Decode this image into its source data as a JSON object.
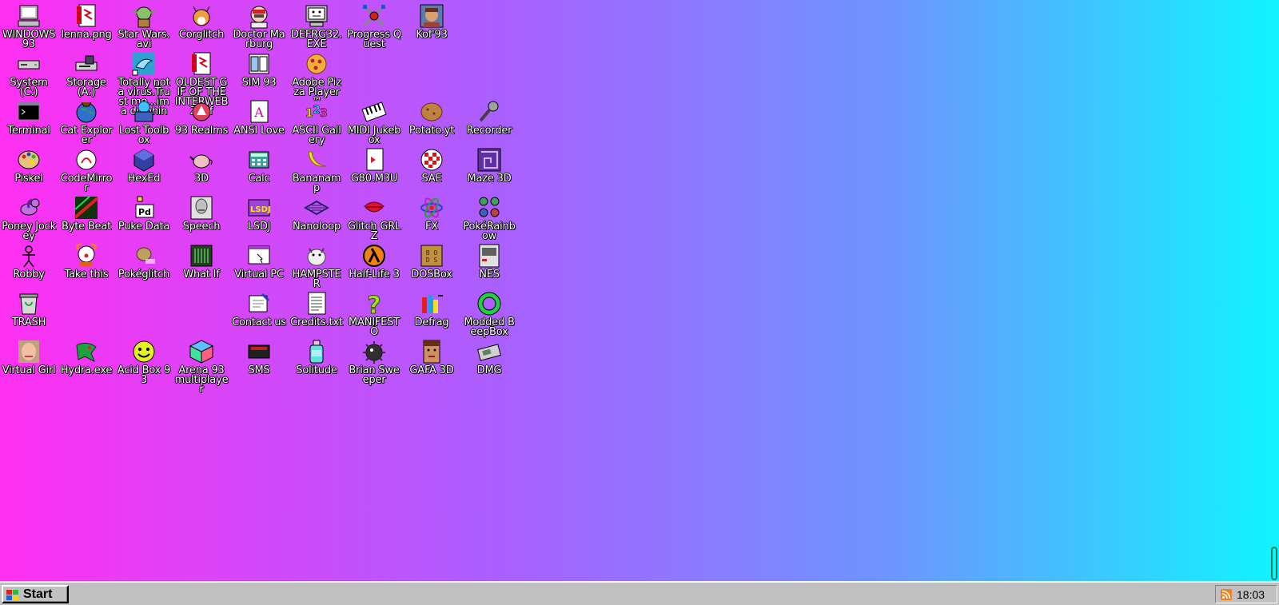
{
  "desktop": {
    "icons": [
      {
        "label": "WINDOWS 93",
        "icon": "computer-icon"
      },
      {
        "label": "lenna.png",
        "icon": "image-file-icon"
      },
      {
        "label": "Star Wars.avi",
        "icon": "yoda-icon"
      },
      {
        "label": "Corglitch",
        "icon": "corgi-icon"
      },
      {
        "label": "Doctor Marburg",
        "icon": "doctor-icon"
      },
      {
        "label": "DEFRG32.EXE",
        "icon": "monitor-face-icon"
      },
      {
        "label": "Progress Quest",
        "icon": "crossed-swords-icon"
      },
      {
        "label": "Kof'93",
        "icon": "fighter-portrait-icon"
      },
      {
        "label": "System (C:)",
        "icon": "hard-drive-icon"
      },
      {
        "label": "Storage (A:)",
        "icon": "floppy-drive-icon"
      },
      {
        "label": "Totally not a virus.Trust me...im a dolphin",
        "icon": "dolphin-icon"
      },
      {
        "label": "OLDEST GIF OF THE INTERWEBZ.gif",
        "icon": "gif-file-icon"
      },
      {
        "label": "SIM 93",
        "icon": "book-icon"
      },
      {
        "label": "Adobe Pizza Player™",
        "icon": "pizza-icon"
      },
      {
        "label": "Terminal",
        "icon": "terminal-icon"
      },
      {
        "label": "Cat Explorer",
        "icon": "globe-cat-icon"
      },
      {
        "label": "Lost Toolbox",
        "icon": "toolbox-icon"
      },
      {
        "label": "93 Realms",
        "icon": "realms-icon"
      },
      {
        "label": "ANSI Love",
        "icon": "ansi-icon"
      },
      {
        "label": "ASCII Gallery",
        "icon": "ascii-icon"
      },
      {
        "label": "MIDI Jukebox",
        "icon": "piano-keys-icon"
      },
      {
        "label": "Potato.yt",
        "icon": "potato-icon"
      },
      {
        "label": "Recorder",
        "icon": "microphone-icon"
      },
      {
        "label": "Piskel",
        "icon": "palette-icon"
      },
      {
        "label": "CodeMirror",
        "icon": "codemirror-icon"
      },
      {
        "label": "HexEd",
        "icon": "hex-cube-icon"
      },
      {
        "label": "3D",
        "icon": "teapot-icon"
      },
      {
        "label": "Calc",
        "icon": "calculator-icon"
      },
      {
        "label": "Bananamp",
        "icon": "banana-icon"
      },
      {
        "label": "G80.M3U",
        "icon": "playlist-file-icon"
      },
      {
        "label": "SAE",
        "icon": "amiga-ball-icon"
      },
      {
        "label": "Maze 3D",
        "icon": "maze-icon"
      },
      {
        "label": "Poney Jockey",
        "icon": "pony-icon"
      },
      {
        "label": "Byte Beat",
        "icon": "bytebeat-icon"
      },
      {
        "label": "Puke Data",
        "icon": "puredata-icon"
      },
      {
        "label": "Speech",
        "icon": "speech-face-icon"
      },
      {
        "label": "LSDJ",
        "icon": "lsdj-icon"
      },
      {
        "label": "Nanoloop",
        "icon": "nanoloop-icon"
      },
      {
        "label": "Glitch GRLZ",
        "icon": "lips-icon"
      },
      {
        "label": "FX",
        "icon": "atom-icon"
      },
      {
        "label": "PokéRainbow",
        "icon": "trainers-icon"
      },
      {
        "label": "Robby",
        "icon": "stick-figure-icon"
      },
      {
        "label": "Take this",
        "icon": "clown-icon"
      },
      {
        "label": "Pokéglitch",
        "icon": "glitch-creature-icon"
      },
      {
        "label": "What If",
        "icon": "whatif-icon"
      },
      {
        "label": "Virtual PC",
        "icon": "window-app-icon"
      },
      {
        "label": "HAMPSTER",
        "icon": "hamster-icon"
      },
      {
        "label": "Half-Life 3",
        "icon": "lambda-icon"
      },
      {
        "label": "DOSBox",
        "icon": "dosbox-icon"
      },
      {
        "label": "NES",
        "icon": "nes-console-icon"
      },
      {
        "label": "TRASH",
        "icon": "trash-icon"
      },
      {
        "label": "Contact us",
        "icon": "contact-form-icon"
      },
      {
        "label": "Credits.txt",
        "icon": "text-file-icon"
      },
      {
        "label": "MANIFESTO",
        "icon": "question-mark-icon"
      },
      {
        "label": "Defrag",
        "icon": "defrag-icon"
      },
      {
        "label": "Modded BeepBox",
        "icon": "beepbox-ring-icon"
      },
      {
        "label": "Virtual Girl",
        "icon": "girl-portrait-icon"
      },
      {
        "label": "Hydra.exe",
        "icon": "hydra-icon"
      },
      {
        "label": "Acid Box 93",
        "icon": "smiley-icon"
      },
      {
        "label": "Arena 93 multiplayer",
        "icon": "color-cube-icon"
      },
      {
        "label": "SMS",
        "icon": "sms-console-icon"
      },
      {
        "label": "Solitude",
        "icon": "bottle-icon"
      },
      {
        "label": "Brian Sweeper",
        "icon": "mine-icon"
      },
      {
        "label": "GAFA 3D",
        "icon": "doomguy-icon"
      },
      {
        "label": "DMG",
        "icon": "gameboy-icon"
      }
    ]
  },
  "taskbar": {
    "start_label": "Start",
    "clock": "18:03"
  }
}
